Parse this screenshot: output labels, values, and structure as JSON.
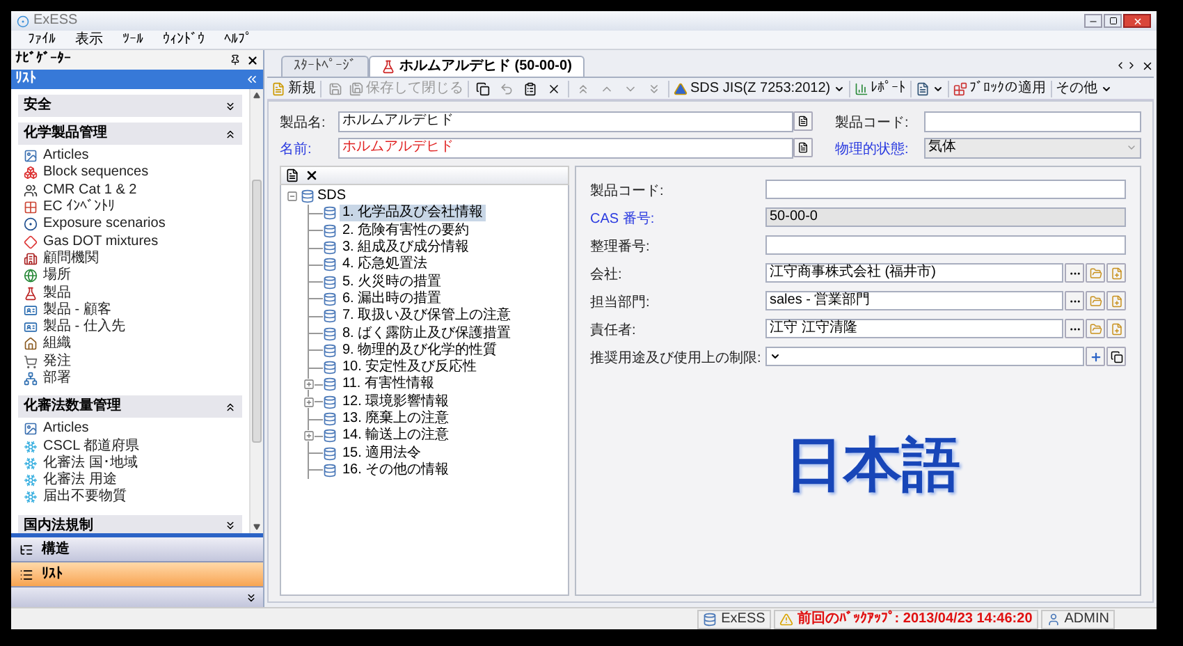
{
  "window": {
    "title": "ExESS"
  },
  "menu": [
    "ﾌｧｲﾙ",
    "表示",
    "ﾂｰﾙ",
    "ｳｨﾝﾄﾞｳ",
    "ﾍﾙﾌﾟ"
  ],
  "navigator": {
    "title": "ﾅﾋﾞｹﾞｰﾀｰ",
    "panel_title": "ﾘｽﾄ",
    "groups": [
      {
        "title": "安全",
        "expanded": false
      },
      {
        "title": "化学製品管理",
        "expanded": true,
        "items": [
          "Articles",
          "Block sequences",
          "CMR Cat 1 & 2",
          "EC ｲﾝﾍﾞﾝﾄﾘ",
          "Exposure scenarios",
          "Gas DOT mixtures",
          "顧問機関",
          "場所",
          "製品",
          "製品 - 顧客",
          "製品 - 仕入先",
          "組織",
          "発注",
          "部署"
        ]
      },
      {
        "title": "化審法数量管理",
        "expanded": true,
        "items": [
          "Articles",
          "CSCL 都道府県",
          "化審法 国･地域",
          "化審法 用途",
          "届出不要物質"
        ]
      },
      {
        "title": "国内法規制",
        "expanded": false
      }
    ],
    "buttons": [
      {
        "label": "構造",
        "selected": false
      },
      {
        "label": "ﾘｽﾄ",
        "selected": true
      }
    ]
  },
  "tabs": [
    {
      "label": "ｽﾀｰﾄﾍﾟｰｼﾞ",
      "selected": false
    },
    {
      "label": "ホルムアルデヒド (50-00-0)",
      "selected": true
    }
  ],
  "toolbar": [
    {
      "kind": "button",
      "label": "新規",
      "disabled": false
    },
    {
      "kind": "separator"
    },
    {
      "kind": "icon",
      "disabled": true
    },
    {
      "kind": "button",
      "label": "保存して閉じる",
      "disabled": true
    },
    {
      "kind": "separator"
    },
    {
      "kind": "icon",
      "disabled": false
    },
    {
      "kind": "icon",
      "disabled": true
    },
    {
      "kind": "icon",
      "disabled": false
    },
    {
      "kind": "icon",
      "disabled": false
    },
    {
      "kind": "separator"
    },
    {
      "kind": "icon",
      "disabled": true
    },
    {
      "kind": "icon",
      "disabled": true
    },
    {
      "kind": "icon",
      "disabled": true
    },
    {
      "kind": "icon",
      "disabled": true
    },
    {
      "kind": "separator"
    },
    {
      "kind": "dropdown",
      "label": "SDS JIS(Z 7253:2012)",
      "disabled": false
    },
    {
      "kind": "separator"
    },
    {
      "kind": "button",
      "label": "ﾚﾎﾟｰﾄ",
      "disabled": false
    },
    {
      "kind": "separator"
    },
    {
      "kind": "dropdown",
      "disabled": false
    },
    {
      "kind": "separator"
    },
    {
      "kind": "button",
      "label": "ﾌﾞﾛｯｸの適用",
      "disabled": false
    },
    {
      "kind": "separator"
    },
    {
      "kind": "dropdown",
      "label": "その他",
      "disabled": false
    }
  ],
  "header_fields": [
    {
      "label": "製品名:",
      "value": "ホルムアルデヒド",
      "highlight": false,
      "red_value": false
    },
    {
      "label": "名前:",
      "value": "ホルムアルデヒド",
      "highlight": true,
      "red_value": true
    }
  ],
  "side_fields": [
    {
      "label": "製品コード:",
      "highlight": false,
      "disabled": false
    },
    {
      "label": "物理的状態:",
      "value": "気体",
      "highlight": true,
      "disabled": true
    }
  ],
  "tree": {
    "label": "SDS",
    "expanded": true,
    "children": [
      {
        "label": "1. 化学品及び会社情報",
        "selected": true,
        "expandable": false
      },
      {
        "label": "2. 危険有害性の要約",
        "selected": false,
        "expandable": false
      },
      {
        "label": "3. 組成及び成分情報",
        "selected": false,
        "expandable": false
      },
      {
        "label": "4. 応急処置法",
        "selected": false,
        "expandable": false
      },
      {
        "label": "5. 火災時の措置",
        "selected": false,
        "expandable": false
      },
      {
        "label": "6. 漏出時の措置",
        "selected": false,
        "expandable": false
      },
      {
        "label": "7. 取扱い及び保管上の注意",
        "selected": false,
        "expandable": false
      },
      {
        "label": "8. ばく露防止及び保護措置",
        "selected": false,
        "expandable": false
      },
      {
        "label": "9. 物理的及び化学的性質",
        "selected": false,
        "expandable": false
      },
      {
        "label": "10. 安定性及び反応性",
        "selected": false,
        "expandable": false
      },
      {
        "label": "11. 有害性情報",
        "selected": false,
        "expandable": true
      },
      {
        "label": "12. 環境影響情報",
        "selected": false,
        "expandable": true
      },
      {
        "label": "13. 廃棄上の注意",
        "selected": false,
        "expandable": false
      },
      {
        "label": "14. 輸送上の注意",
        "selected": false,
        "expandable": true
      },
      {
        "label": "15. 適用法令",
        "selected": false,
        "expandable": false
      },
      {
        "label": "16. その他の情報",
        "selected": false,
        "expandable": false
      }
    ]
  },
  "detail_fields": [
    {
      "kind": "text",
      "label": "製品コード:",
      "highlight": false
    },
    {
      "kind": "readonly",
      "label": "CAS 番号:",
      "value": "50-00-0",
      "highlight": true
    },
    {
      "kind": "text",
      "label": "整理番号:",
      "highlight": false
    },
    {
      "kind": "lookup",
      "label": "会社:",
      "value": "江守商事株式会社 (福井市)",
      "highlight": false
    },
    {
      "kind": "lookup",
      "label": "担当部門:",
      "value": "sales - 営業部門",
      "highlight": false
    },
    {
      "kind": "lookup",
      "label": "責任者:",
      "value": "江守 江守清隆",
      "highlight": false
    },
    {
      "kind": "combo",
      "label": "推奨用途及び使用上の制限:",
      "highlight": false
    }
  ],
  "overlay_label": "日本語",
  "status_bar": [
    {
      "kind": "database",
      "text": "ExESS",
      "alert": false
    },
    {
      "kind": "backup",
      "text": "前回のﾊﾞｯｸｱｯﾌﾟ: 2013/04/23 14:46:20",
      "alert": true
    },
    {
      "kind": "user",
      "text": "ADMIN",
      "alert": false
    }
  ]
}
